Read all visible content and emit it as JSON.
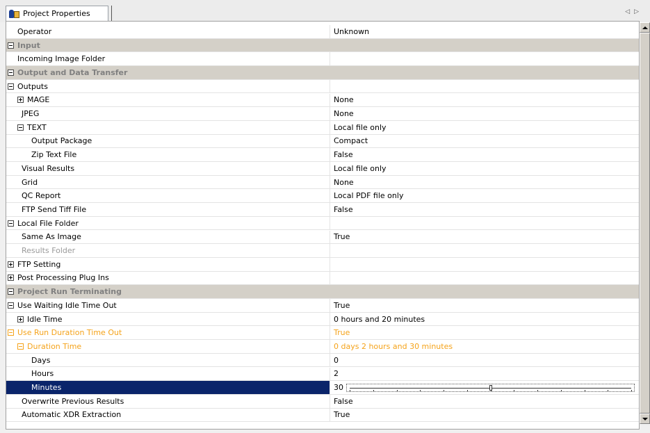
{
  "tab": {
    "label": "Project Properties",
    "icon": "project-properties-icon"
  },
  "colors": {
    "category_bg": "#d4d0c8",
    "category_text": "#808080",
    "selected_bg": "#0a246a",
    "highlight_text": "#f5a31a"
  },
  "rows": [
    {
      "name": "Operator",
      "value": "Unknown",
      "depth": 0
    },
    {
      "name": "Input",
      "value": "",
      "depth": 0,
      "category": true,
      "expander": "minus"
    },
    {
      "name": "Incoming Image Folder",
      "value": "",
      "depth": 0
    },
    {
      "name": "Output and Data Transfer",
      "value": "",
      "depth": 0,
      "category": true,
      "expander": "minus"
    },
    {
      "name": "Outputs",
      "value": "",
      "depth": 0,
      "expander": "minus"
    },
    {
      "name": "MAGE",
      "value": "None",
      "depth": 1,
      "expander": "plus"
    },
    {
      "name": "JPEG",
      "value": "None",
      "depth": 1
    },
    {
      "name": "TEXT",
      "value": "Local file only",
      "depth": 1,
      "expander": "minus"
    },
    {
      "name": "Output Package",
      "value": "Compact",
      "depth": 2
    },
    {
      "name": "Zip Text File",
      "value": "False",
      "depth": 2
    },
    {
      "name": "Visual Results",
      "value": "Local file only",
      "depth": 1
    },
    {
      "name": "Grid",
      "value": "None",
      "depth": 1
    },
    {
      "name": "QC Report",
      "value": "Local PDF file only",
      "depth": 1
    },
    {
      "name": "FTP Send Tiff File",
      "value": "False",
      "depth": 1
    },
    {
      "name": "Local File Folder",
      "value": "",
      "depth": 0,
      "expander": "minus"
    },
    {
      "name": "Same As Image",
      "value": "True",
      "depth": 1
    },
    {
      "name": "Results Folder",
      "value": "",
      "depth": 1,
      "dim": true
    },
    {
      "name": "FTP Setting",
      "value": "",
      "depth": 0,
      "expander": "plus"
    },
    {
      "name": "Post Processing Plug Ins",
      "value": "",
      "depth": 0,
      "expander": "plus"
    },
    {
      "name": "Project Run Terminating",
      "value": "",
      "depth": 0,
      "category": true,
      "expander": "minus"
    },
    {
      "name": "Use Waiting  Idle Time Out",
      "value": "True",
      "depth": 0,
      "expander": "minus"
    },
    {
      "name": "Idle Time",
      "value": "0 hours and 20 minutes",
      "depth": 1,
      "expander": "plus"
    },
    {
      "name": "Use Run Duration Time Out",
      "value": "True",
      "depth": 0,
      "expander": "minus",
      "highlight": true
    },
    {
      "name": "Duration Time",
      "value": "0 days 2 hours and 30 minutes",
      "depth": 1,
      "expander": "minus",
      "highlight": true
    },
    {
      "name": "Days",
      "value": "0",
      "depth": 2
    },
    {
      "name": "Hours",
      "value": "2",
      "depth": 2
    },
    {
      "name": "Minutes",
      "value": "30",
      "depth": 2,
      "selected": true,
      "editor": "slider",
      "slider_fraction": 0.5
    },
    {
      "name": "Overwrite Previous Results",
      "value": "False",
      "depth": 1
    },
    {
      "name": "Automatic XDR Extraction",
      "value": "True",
      "depth": 1
    }
  ]
}
